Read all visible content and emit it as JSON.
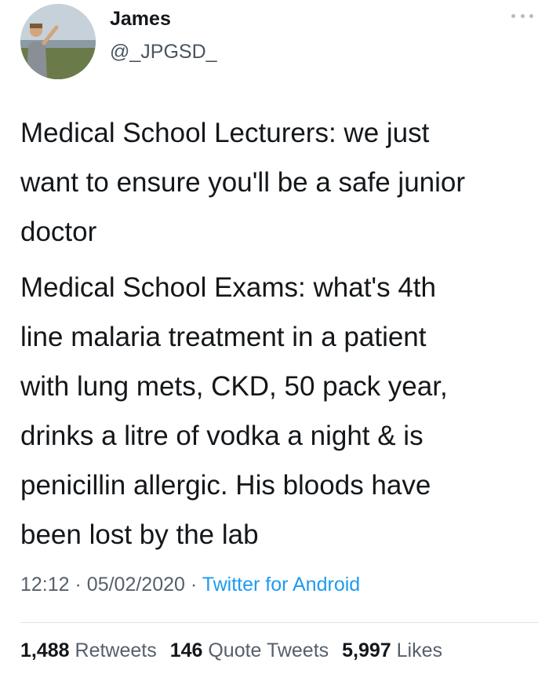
{
  "author": {
    "name": "James",
    "handle": "@_JPGSD_",
    "avatar_icon": "profile-photo-person-on-hillside"
  },
  "menu_icon": "more-options-icon",
  "tweet": {
    "paragraphs": [
      "Medical School Lecturers: we just\nwant to ensure you'll be a safe junior\ndoctor",
      "Medical School Exams: what's 4th\nline malaria treatment in a patient\nwith lung mets, CKD, 50 pack year,\ndrinks a litre of vodka a night & is\npenicillin allergic. His bloods have\nbeen lost by the lab"
    ]
  },
  "meta": {
    "time": "12:12",
    "separator": "·",
    "date": "05/02/2020",
    "source": "Twitter for Android"
  },
  "stats": {
    "retweets_count": "1,488",
    "retweets_label": "Retweets",
    "quote_count": "146",
    "quote_label": "Quote Tweets",
    "likes_count": "5,997",
    "likes_label": "Likes"
  },
  "colors": {
    "text": "#14171a",
    "secondary": "#56606b",
    "link": "#1d9bf0"
  }
}
